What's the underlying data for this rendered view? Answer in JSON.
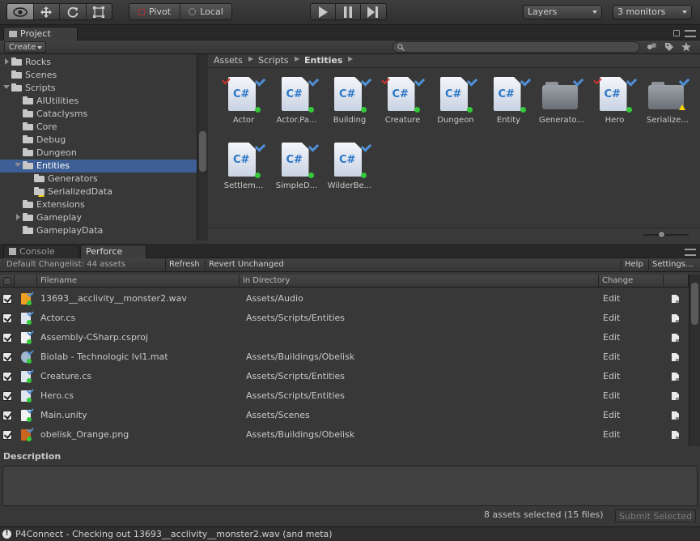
{
  "toolbar": {
    "pivot_label": "Pivot",
    "local_label": "Local",
    "layers_label": "Layers",
    "layout_label": "3 monitors"
  },
  "project": {
    "tab_label": "Project",
    "create_label": "Create",
    "search_placeholder": "",
    "tree": [
      {
        "label": "Rocks",
        "indent": 1,
        "expander": "right"
      },
      {
        "label": "Scenes",
        "indent": 1,
        "expander": "none"
      },
      {
        "label": "Scripts",
        "indent": 1,
        "expander": "down"
      },
      {
        "label": "AIUtilities",
        "indent": 2,
        "expander": "none"
      },
      {
        "label": "Cataclysms",
        "indent": 2,
        "expander": "none"
      },
      {
        "label": "Core",
        "indent": 2,
        "expander": "none"
      },
      {
        "label": "Debug",
        "indent": 2,
        "expander": "none"
      },
      {
        "label": "Dungeon",
        "indent": 2,
        "expander": "none"
      },
      {
        "label": "Entities",
        "indent": 2,
        "expander": "down",
        "selected": true
      },
      {
        "label": "Generators",
        "indent": 3,
        "expander": "none"
      },
      {
        "label": "SerializedData",
        "indent": 3,
        "expander": "none",
        "warning": true
      },
      {
        "label": "Extensions",
        "indent": 2,
        "expander": "none"
      },
      {
        "label": "Gameplay",
        "indent": 2,
        "expander": "right"
      },
      {
        "label": "GameplayData",
        "indent": 2,
        "expander": "none"
      }
    ],
    "breadcrumb": [
      "Assets",
      "Scripts",
      "Entities"
    ],
    "assets": [
      {
        "label": "Actor",
        "kind": "cs",
        "red": true
      },
      {
        "label": "Actor.Pa...",
        "kind": "cs",
        "red": false
      },
      {
        "label": "Building",
        "kind": "cs",
        "red": false
      },
      {
        "label": "Creature",
        "kind": "cs",
        "red": true
      },
      {
        "label": "Dungeon",
        "kind": "cs",
        "red": false
      },
      {
        "label": "Entity",
        "kind": "cs",
        "red": false
      },
      {
        "label": "Generato...",
        "kind": "folder",
        "red": false
      },
      {
        "label": "Hero",
        "kind": "cs",
        "red": true
      },
      {
        "label": "Serialize...",
        "kind": "folder",
        "red": false,
        "warning": true
      },
      {
        "label": "Settlem...",
        "kind": "cs",
        "red": false
      },
      {
        "label": "SimpleD...",
        "kind": "cs",
        "red": false
      },
      {
        "label": "WilderBe...",
        "kind": "cs",
        "red": false
      }
    ]
  },
  "perforce": {
    "console_tab": "Console",
    "perforce_tab": "Perforce",
    "changelist_label": "Default Changelist: 44 assets",
    "refresh_label": "Refresh",
    "revert_label": "Revert Unchanged",
    "help_label": "Help",
    "settings_label": "Settings...",
    "columns": {
      "filename": "Filename",
      "directory": "in Directory",
      "change": "Change"
    },
    "rows": [
      {
        "file": "13693__acclivity__monster2.wav",
        "dir": "Assets/Audio",
        "change": "Edit",
        "icon": "audio-icon"
      },
      {
        "file": "Actor.cs",
        "dir": "Assets/Scripts/Entities",
        "change": "Edit",
        "icon": "cs-icon"
      },
      {
        "file": "Assembly-CSharp.csproj",
        "dir": "",
        "change": "Edit",
        "icon": "doc-icon"
      },
      {
        "file": "Biolab - Technologic lvl1.mat",
        "dir": "Assets/Buildings/Obelisk",
        "change": "Edit",
        "icon": "material-icon"
      },
      {
        "file": "Creature.cs",
        "dir": "Assets/Scripts/Entities",
        "change": "Edit",
        "icon": "cs-icon"
      },
      {
        "file": "Hero.cs",
        "dir": "Assets/Scripts/Entities",
        "change": "Edit",
        "icon": "cs-icon"
      },
      {
        "file": "Main.unity",
        "dir": "Assets/Scenes",
        "change": "Edit",
        "icon": "unity-icon"
      },
      {
        "file": "obelisk_Orange.png",
        "dir": "Assets/Buildings/Obelisk",
        "change": "Edit",
        "icon": "image-icon"
      }
    ],
    "description_label": "Description",
    "selection_status": "8 assets selected (15 files)",
    "submit_label": "Submit Selected"
  },
  "status_bar": {
    "message": "P4Connect - Checking out 13693__acclivity__monster2.wav (and meta)"
  },
  "colors": {
    "selection": "#3e5f96",
    "check_blue": "#4f8fd6",
    "check_red": "#d0342c",
    "status_green": "#33c93a"
  }
}
